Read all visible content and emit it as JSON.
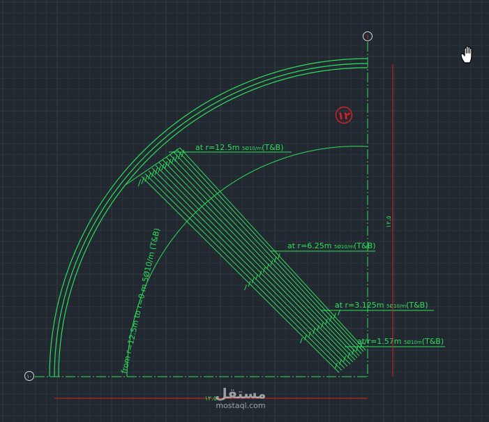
{
  "annotations": {
    "r1": {
      "prefix": "at  r=12.5m",
      "bar": "5Ø10/m",
      "suffix": "(T&B)"
    },
    "r2": {
      "prefix": "at  r=6.25m",
      "bar": "5Ø10/m",
      "suffix": "(T&B)"
    },
    "r3": {
      "prefix": "at  r=3.125m",
      "bar": "5Ø10/m",
      "suffix": "(T&B)"
    },
    "r4": {
      "prefix": "at  r=1.57m",
      "bar": "5Ø10m",
      "suffix": "(T&B)"
    },
    "curved": "from  r=12.5m  to  r=0 m  5Ø10/m (T&B)"
  },
  "markers": {
    "axis_top": "١",
    "axis_left": "١٠",
    "section_number": "١٢"
  },
  "dimensions": {
    "right_dim_text": "١٢.٥",
    "bottom_dim_text": "١٢.٥"
  },
  "watermark": {
    "arabic": "مستقل",
    "latin": "mostaql.com"
  },
  "icons": {
    "cursor": "hand-pan-icon"
  },
  "colors": {
    "background": "#212830",
    "rebar": "#2de05a",
    "dimension": "#e02020",
    "section_circle": "#e02020"
  }
}
